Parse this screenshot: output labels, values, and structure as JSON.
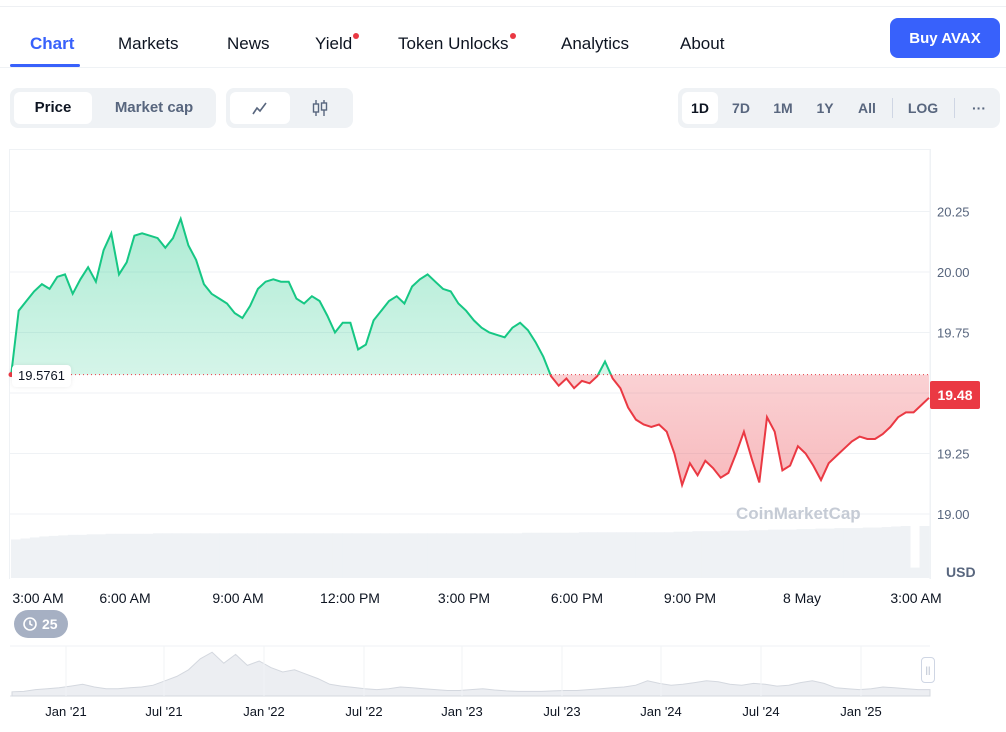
{
  "tabs": [
    {
      "label": "Chart",
      "active": true
    },
    {
      "label": "Markets"
    },
    {
      "label": "News"
    },
    {
      "label": "Yield",
      "dot": true
    },
    {
      "label": "Token Unlocks",
      "dot": true
    },
    {
      "label": "Analytics"
    },
    {
      "label": "About"
    }
  ],
  "buy_button": "Buy AVAX",
  "mode_toggle": {
    "options": [
      "Price",
      "Market cap"
    ],
    "selected": "Price"
  },
  "chart_style_toggle": {
    "options": [
      "line-chart-icon",
      "candlestick-icon"
    ],
    "selected": "line-chart-icon"
  },
  "ranges": {
    "options": [
      "1D",
      "7D",
      "1M",
      "1Y",
      "All"
    ],
    "selected": "1D",
    "log_label": "LOG",
    "more_label": "···"
  },
  "watermark": "CoinMarketCap",
  "open_price_label": "19.5761",
  "current_price_label": "19.48",
  "currency_label": "USD",
  "history_badge": "25",
  "navigator": {
    "labels": [
      "Jan '21",
      "Jul '21",
      "Jan '22",
      "Jul '22",
      "Jan '23",
      "Jul '23",
      "Jan '24",
      "Jul '24",
      "Jan '25"
    ]
  },
  "colors": {
    "accent": "#3861fb",
    "up": "#16c784",
    "down": "#ea3943"
  },
  "chart_data": {
    "type": "line",
    "title": "",
    "xlabel": "",
    "ylabel": "USD",
    "x_ticks": [
      "3:00 AM",
      "6:00 AM",
      "9:00 AM",
      "12:00 PM",
      "3:00 PM",
      "6:00 PM",
      "9:00 PM",
      "8 May",
      "3:00 AM"
    ],
    "y_ticks": [
      19.0,
      19.25,
      19.5,
      19.75,
      20.0,
      20.25
    ],
    "y_tick_labels": [
      "19.00",
      "19.25",
      "19.50",
      "19.75",
      "20.00",
      "20.25"
    ],
    "ylim": [
      18.75,
      20.5
    ],
    "baseline": 19.5761,
    "current": 19.48,
    "series": [
      {
        "values": [
          19.57,
          19.84,
          19.88,
          19.92,
          19.95,
          19.93,
          19.98,
          19.99,
          19.91,
          19.97,
          20.02,
          19.96,
          20.09,
          20.16,
          19.99,
          20.04,
          20.15,
          20.16,
          20.15,
          20.14,
          20.1,
          20.14,
          20.22,
          20.11,
          20.05,
          19.95,
          19.91,
          19.89,
          19.87,
          19.83,
          19.81,
          19.86,
          19.93,
          19.96,
          19.97,
          19.96,
          19.96,
          19.89,
          19.87,
          19.9,
          19.88,
          19.82,
          19.75,
          19.79,
          19.79,
          19.68,
          19.7,
          19.8,
          19.84,
          19.88,
          19.9,
          19.87,
          19.94,
          19.97,
          19.99,
          19.96,
          19.93,
          19.92,
          19.87,
          19.84,
          19.8,
          19.77,
          19.75,
          19.74,
          19.73,
          19.77,
          19.79,
          19.76,
          19.71,
          19.65,
          19.57,
          19.53,
          19.56,
          19.52,
          19.55,
          19.54,
          19.57,
          19.63,
          19.56,
          19.52,
          19.44,
          19.39,
          19.37,
          19.36,
          19.37,
          19.34,
          19.25,
          19.12,
          19.21,
          19.16,
          19.22,
          19.19,
          19.15,
          19.17,
          19.25,
          19.34,
          19.23,
          19.13,
          19.4,
          19.34,
          19.18,
          19.2,
          19.28,
          19.25,
          19.2,
          19.14,
          19.21,
          19.24,
          19.27,
          19.3,
          19.32,
          19.31,
          19.31,
          19.33,
          19.36,
          19.4,
          19.42,
          19.42,
          19.45,
          19.48
        ]
      }
    ],
    "volume": [
      0.74,
      0.76,
      0.78,
      0.8,
      0.81,
      0.82,
      0.83,
      0.83,
      0.84,
      0.84,
      0.85,
      0.85,
      0.85,
      0.85,
      0.85,
      0.86,
      0.86,
      0.86,
      0.86,
      0.86,
      0.86,
      0.86,
      0.86,
      0.86,
      0.86,
      0.86,
      0.86,
      0.86,
      0.86,
      0.86,
      0.86,
      0.86,
      0.86,
      0.86,
      0.86,
      0.86,
      0.86,
      0.86,
      0.86,
      0.86,
      0.86,
      0.86,
      0.86,
      0.86,
      0.86,
      0.86,
      0.86,
      0.86,
      0.86,
      0.86,
      0.86,
      0.86,
      0.86,
      0.86,
      0.87,
      0.87,
      0.87,
      0.87,
      0.87,
      0.87,
      0.88,
      0.88,
      0.88,
      0.88,
      0.88,
      0.88,
      0.88,
      0.88,
      0.88,
      0.88,
      0.89,
      0.89,
      0.9,
      0.9,
      0.9,
      0.91,
      0.91,
      0.91,
      0.92,
      0.92,
      0.93,
      0.93,
      0.93,
      0.94,
      0.94,
      0.95,
      0.95,
      0.96,
      0.96,
      0.96,
      0.97,
      0.97,
      0.98,
      0.99,
      1.0,
      0.2,
      1.0
    ],
    "navigator_series": [
      0.05,
      0.06,
      0.1,
      0.12,
      0.14,
      0.18,
      0.22,
      0.16,
      0.12,
      0.12,
      0.14,
      0.16,
      0.2,
      0.3,
      0.4,
      0.55,
      0.8,
      0.95,
      0.7,
      0.9,
      0.65,
      0.75,
      0.6,
      0.5,
      0.55,
      0.45,
      0.35,
      0.22,
      0.18,
      0.15,
      0.12,
      0.1,
      0.12,
      0.16,
      0.14,
      0.12,
      0.1,
      0.08,
      0.08,
      0.1,
      0.12,
      0.09,
      0.07,
      0.06,
      0.06,
      0.06,
      0.07,
      0.08,
      0.08,
      0.1,
      0.12,
      0.14,
      0.16,
      0.2,
      0.3,
      0.24,
      0.2,
      0.22,
      0.26,
      0.3,
      0.28,
      0.22,
      0.2,
      0.24,
      0.22,
      0.18,
      0.2,
      0.26,
      0.3,
      0.24,
      0.14,
      0.12,
      0.1,
      0.12,
      0.16,
      0.14,
      0.12,
      0.1,
      0.1
    ]
  }
}
